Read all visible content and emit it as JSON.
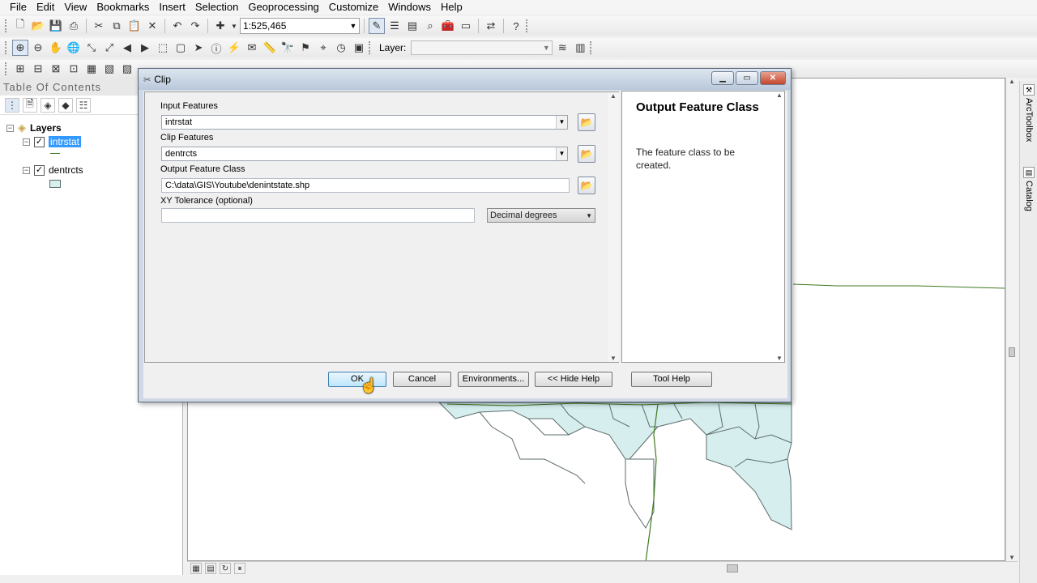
{
  "menu": {
    "items": [
      "File",
      "Edit",
      "View",
      "Bookmarks",
      "Insert",
      "Selection",
      "Geoprocessing",
      "Customize",
      "Windows",
      "Help"
    ]
  },
  "toolbar": {
    "scale": "1:525,465",
    "layer_label": "Layer:",
    "layer_value": ""
  },
  "toc": {
    "title": "Table Of Contents",
    "root": "Layers",
    "layers": [
      {
        "name": "intrstat",
        "checked": true,
        "selected": true
      },
      {
        "name": "dentrcts",
        "checked": true,
        "selected": false
      }
    ]
  },
  "dialog": {
    "title": "Clip",
    "params": {
      "input_label": "Input Features",
      "input_value": "intrstat",
      "clip_label": "Clip Features",
      "clip_value": "dentrcts",
      "output_label": "Output Feature Class",
      "output_value": "C:\\data\\GIS\\Youtube\\denintstate.shp",
      "xy_label": "XY Tolerance (optional)",
      "xy_value": "",
      "xy_units": "Decimal degrees"
    },
    "help": {
      "title": "Output Feature Class",
      "text": "The feature class to be created."
    },
    "buttons": {
      "ok": "OK",
      "cancel": "Cancel",
      "environments": "Environments...",
      "hide_help": "<< Hide Help",
      "tool_help": "Tool Help"
    }
  },
  "side_tabs": {
    "arctoolbox": "ArcToolbox",
    "catalog": "Catalog"
  },
  "colors": {
    "polygon_fill": "#d6eeee",
    "polygon_stroke": "#5d6b6b",
    "line_stroke": "#3d7a1f",
    "selection": "#3399ff"
  }
}
